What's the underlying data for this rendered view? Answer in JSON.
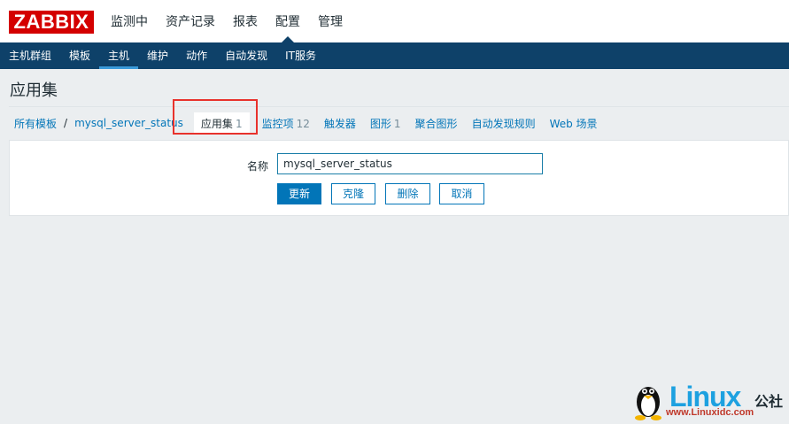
{
  "header": {
    "logo": "ZABBIX",
    "menu": [
      {
        "label": "监测中"
      },
      {
        "label": "资产记录"
      },
      {
        "label": "报表"
      },
      {
        "label": "配置",
        "active": true
      },
      {
        "label": "管理"
      }
    ]
  },
  "subnav": [
    {
      "label": "主机群组"
    },
    {
      "label": "模板"
    },
    {
      "label": "主机",
      "active": true
    },
    {
      "label": "维护"
    },
    {
      "label": "动作"
    },
    {
      "label": "自动发现"
    },
    {
      "label": "IT服务"
    }
  ],
  "page": {
    "title": "应用集"
  },
  "breadcrumb": {
    "root": "所有模板",
    "separator": "/",
    "template": "mysql_server_status"
  },
  "tabs": {
    "current": {
      "label": "应用集",
      "count": "1"
    },
    "items": [
      {
        "label": "监控项",
        "count": "12"
      },
      {
        "label": "触发器",
        "count": ""
      },
      {
        "label": "图形",
        "count": "1"
      },
      {
        "label": "聚合图形",
        "count": ""
      },
      {
        "label": "自动发现规则",
        "count": ""
      },
      {
        "label": "Web 场景",
        "count": ""
      }
    ]
  },
  "form": {
    "name_label": "名称",
    "name_value": "mysql_server_status",
    "buttons": {
      "update": "更新",
      "clone": "克隆",
      "delete": "删除",
      "cancel": "取消"
    }
  },
  "watermark": {
    "brand": "Linux",
    "brand_cn": "公社",
    "url": "www.Linuxidc.com"
  },
  "colors": {
    "brand_red": "#d40000",
    "nav_blue": "#0e4169",
    "link_blue": "#0275b8",
    "highlight_red": "#e8322c"
  }
}
